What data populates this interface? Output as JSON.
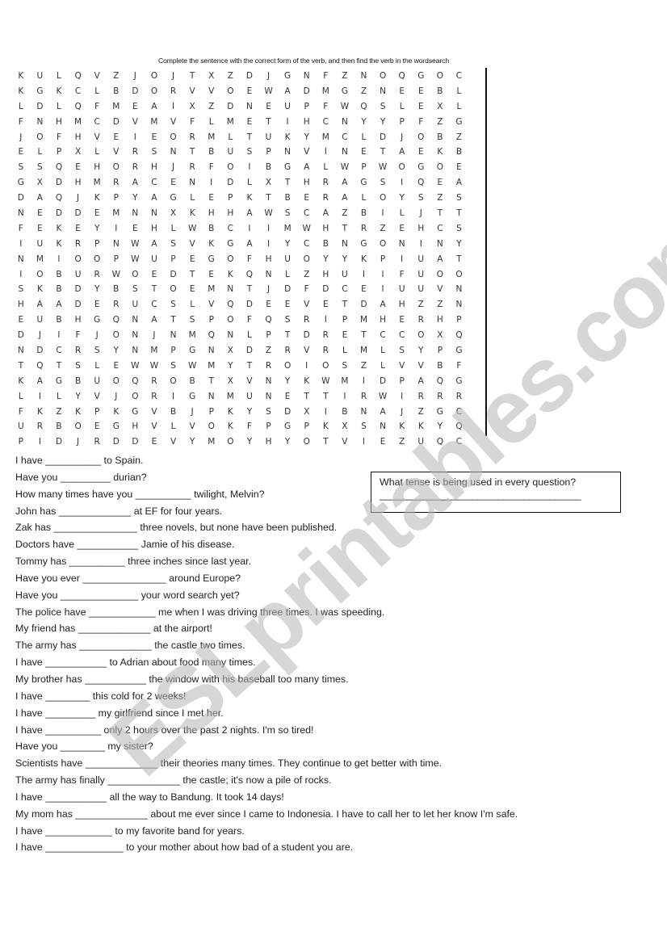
{
  "instructions": "Complete the sentence with the correct form of the verb, and then find the verb in the wordsearch",
  "wordsearch": {
    "rows": [
      "KULQVZJOJTXZDJGNFZNOQGOCL",
      "KGKCLBDORVVOEWADMGZNEEBLS",
      "LDLQFMEAIXZDNEUPFWQSLEXLG",
      "FNHMCDVMVFLMETIHCNYYPFZGP",
      "JOFHVEIEORMLTUKYMCLDJOBZC",
      "ELPXLVRSNTBUSPNVINETAEKBM",
      "SSQEHORHJRFOIBGALWPWOGOEK",
      "GXDHMRACENIDLXTHRAGSIQEAN",
      "DAQJKPYAGLEPKTBERALOYSZSO",
      "NEDDEMNNXKHHAWSCAZBILJTTP",
      "FEKEYIEHLWBCIIMWHTRZEHCSF",
      "IUKRPNWASVKGAIYCBNGONINYW",
      "NMIOOPWUPEGOFHUOYYKPIUATN",
      "IOBURWOEDTEKQNLZHUIIFUOOO",
      "SKBDYBSTOEMNTJDFDCEIUUVNS",
      "HAADERUCSLVQDEEVETDAHZZNH",
      "EUBHGQNATSPOFQSRIPMHERHPW",
      "DJIFJONJNMQNLPTDRETCCOXQD",
      "NDCRSYNMPGNXDZRVRLMLSYPGI",
      "TQTSLEWWSWMYTROIOSZLVVBFX",
      "KAGBUOQROBTXVNYKWMIDPAQGW",
      "LILYVJORIGNMUNETTIRWIRRRP",
      "FKZKPKGVBJPKYSDXIBNAJZGCT",
      "URBOEGHVLVOKFPGPKXSNKKYQB",
      "PIDJRDDEVYMOYHYOTVIEZUQCK"
    ]
  },
  "sentences": [
    "I have __________ to Spain.",
    "Have you _________ durian?",
    "How many times have you __________ twilight, Melvin?",
    "John has _____________ at EF for four years.",
    "Zak has _______________ three novels, but none have been published.",
    "Doctors have ___________ Jamie of his disease.",
    "Tommy has __________ three inches since last year.",
    "Have you ever _______________ around Europe?",
    "Have you ______________ your word search yet?",
    "The police have ____________ me when I was driving three times. I was speeding.",
    "My friend has _____________ at the airport!",
    "The army has _____________ the castle two times.",
    "I have ___________ to Adrian about food many times.",
    "My brother has ___________ the window with his baseball too many times.",
    "I have ________ this cold for 2 weeks!",
    "I have _________ my girlfriend since I met her.",
    "I have __________ only 2 hours over the past 2 nights. I'm so tired!",
    "Have you ________ my sister?",
    "Scientists have _____________ their theories many times. They continue to get better with time.",
    "The army has finally _____________ the castle; it's now a pile of rocks.",
    "I have ___________ all the way to Bandung. It took 14 days!",
    "My mom has _____________ about me ever since I came to Indonesia. I have to call her to let her know I'm safe.",
    "I have ____________ to my favorite band for years.",
    "I have ______________ to your mother about how bad of a student you are."
  ],
  "question_box": {
    "question": "What tense is being used in every question?",
    "answer_line": "_______________________________________"
  },
  "watermark": "ESLprintables.com"
}
